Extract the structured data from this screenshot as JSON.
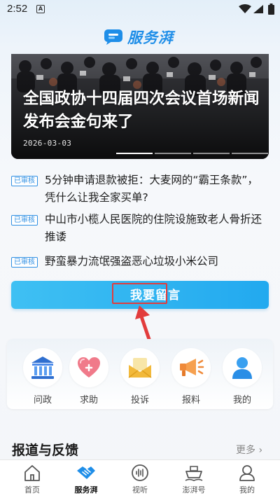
{
  "status_bar": {
    "time": "2:52",
    "notification_letter": "A"
  },
  "header": {
    "app_title": "服务湃"
  },
  "banner": {
    "title": "全国政协十四届四次会议首场新闻发布会金句来了",
    "date": "2026-03-03",
    "dot_count": 4,
    "active_dot": 0
  },
  "news": [
    {
      "badge": "已审核",
      "title": "5分钟申请退款被拒：大麦网的“霸王条款”，凭什么让我全家买单?"
    },
    {
      "badge": "已审核",
      "title": "中山市小榄人民医院的住院设施致老人骨折还推诿"
    },
    {
      "badge": "已审核",
      "title": "野蛮暴力流氓强盗恶心垃圾小米公司"
    }
  ],
  "post_button": {
    "label": "我要留言"
  },
  "services": [
    {
      "label": "问政",
      "icon": "government-building-icon"
    },
    {
      "label": "求助",
      "icon": "heart-help-icon"
    },
    {
      "label": "投诉",
      "icon": "envelope-icon"
    },
    {
      "label": "报料",
      "icon": "megaphone-icon"
    },
    {
      "label": "我的",
      "icon": "person-icon"
    }
  ],
  "section": {
    "title": "报道与反馈",
    "more": "更多 ›"
  },
  "bottom_nav": [
    {
      "label": "首页",
      "icon": "home-icon",
      "active": false
    },
    {
      "label": "服务湃",
      "icon": "handshake-icon",
      "active": true
    },
    {
      "label": "视听",
      "icon": "sound-wave-icon",
      "active": false
    },
    {
      "label": "澎湃号",
      "icon": "ship-icon",
      "active": false
    },
    {
      "label": "我的",
      "icon": "user-icon",
      "active": false
    }
  ],
  "colors": {
    "brand_blue": "#1f8ee8",
    "button_gradient_start": "#3fc0f3",
    "button_gradient_end": "#22a9ef",
    "annotation_red": "#e23c3c",
    "badge_blue": "#2f8fe3"
  }
}
